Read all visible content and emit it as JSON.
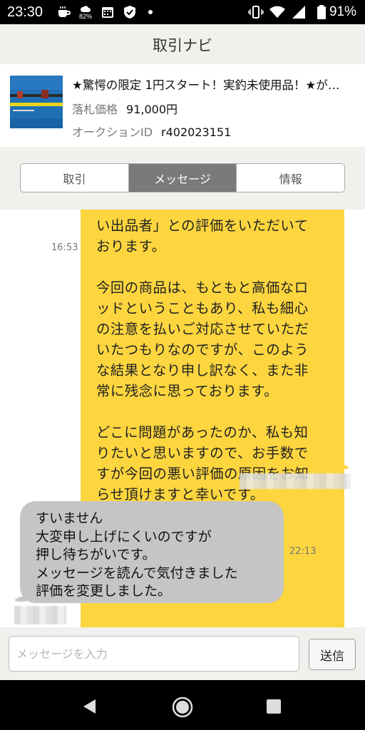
{
  "status_bar": {
    "time": "23:30",
    "notification_badge": "82%",
    "battery": "91%",
    "icons": [
      "coffee-icon",
      "weather-icon",
      "calendar-icon",
      "shield-icon",
      "dot-icon",
      "vibrate-icon",
      "wifi-icon",
      "signal-icon",
      "battery-icon"
    ]
  },
  "header": {
    "title": "取引ナビ"
  },
  "item": {
    "title": "★驚愕の限定 1円スタート！実釣未使用品！★が…",
    "price_label": "落札価格",
    "price_value": "91,000円",
    "auction_label": "オークションID",
    "auction_value": "r402023151"
  },
  "tabs": [
    {
      "label": "取引",
      "active": false
    },
    {
      "label": "メッセージ",
      "active": true
    },
    {
      "label": "情報",
      "active": false
    }
  ],
  "messages": {
    "outgoing": {
      "text": "い出品者」との評価をいただいて\nおります。\n\n今回の商品は、もともと高価なロ\nッドということもあり、私も細心\nの注意を払いご対応させていただ\nいたつもりなのですが、このよう\nな結果となり申し訳なく、また非\n常に残念に思っております。\n\nどこに問題があったのか、私も知\nりたいと思いますので、お手数で\nすが今回の悪い評価の原因をお知\nらせ頂けますと幸いです。",
      "time": "16:53"
    },
    "incoming": {
      "text": "すいません\n大変申し上げにくいのですが\n押し待ちがいです。\nメッセージを読んで気付きました\n評価を変更しました。",
      "time": "22:13"
    }
  },
  "composer": {
    "placeholder": "メッセージを入力",
    "send_label": "送信"
  },
  "colors": {
    "outgoing_bubble": "#fcd53f",
    "incoming_bubble": "#c5c5c5",
    "active_tab": "#7a7a7a",
    "header_bg": "#f1f0ec"
  }
}
